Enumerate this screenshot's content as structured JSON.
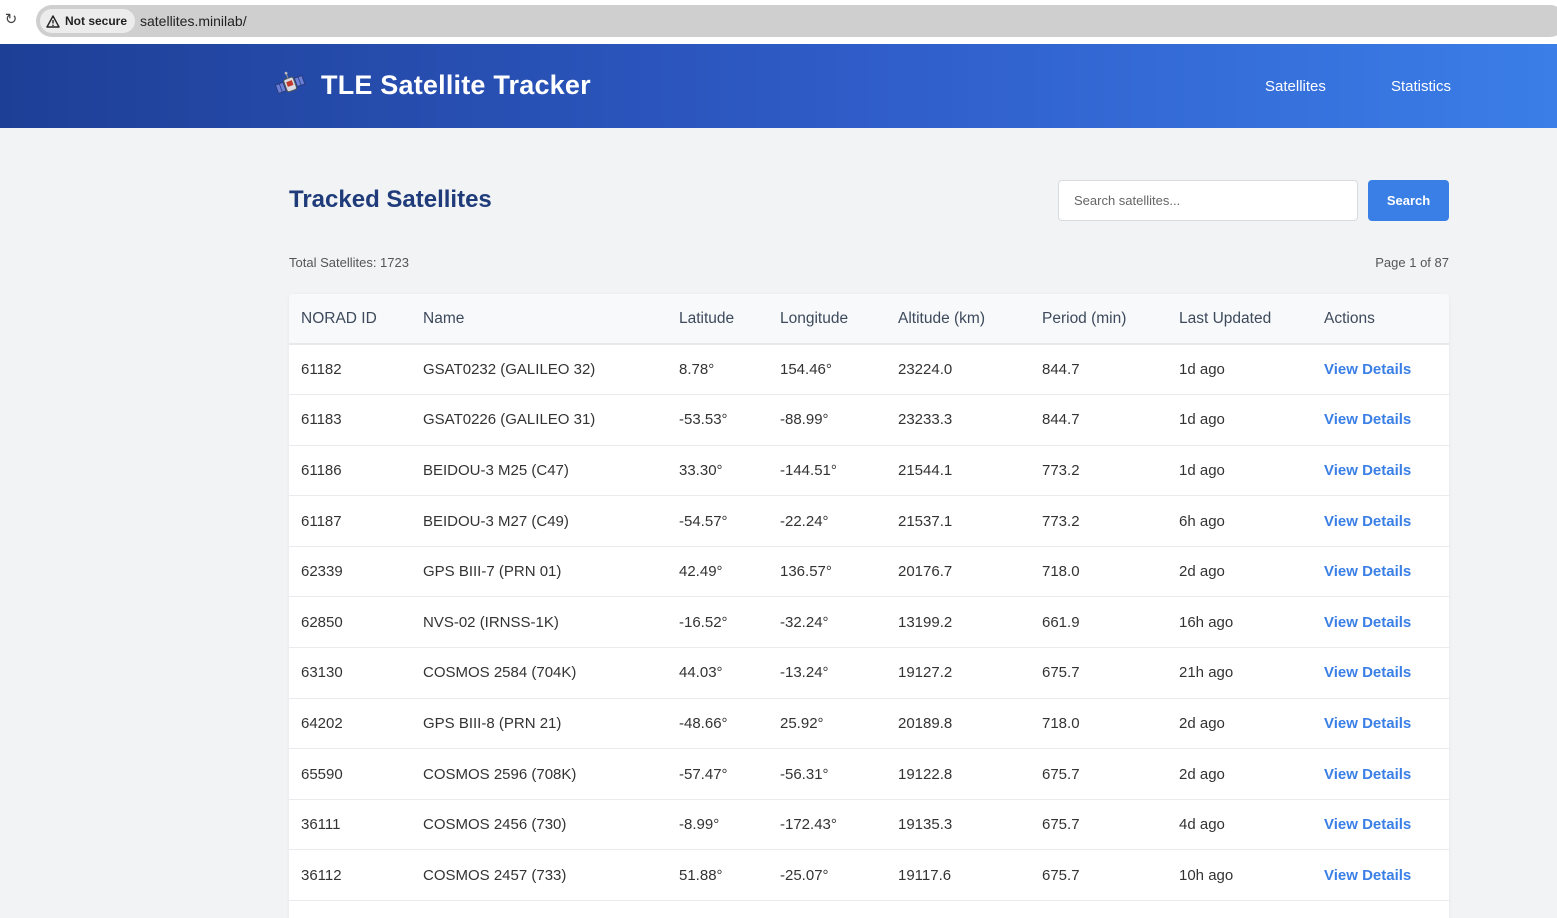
{
  "browser": {
    "security_label": "Not secure",
    "url": "satellites.minilab/"
  },
  "header": {
    "title": "TLE Satellite Tracker",
    "brand_icon": "satellite-icon",
    "nav": {
      "satellites": "Satellites",
      "statistics": "Statistics"
    }
  },
  "main": {
    "title": "Tracked Satellites",
    "search_placeholder": "Search satellites...",
    "search_button": "Search",
    "total": "Total Satellites: 1723",
    "page": "Page 1 of 87"
  },
  "table": {
    "columns": [
      "NORAD ID",
      "Name",
      "Latitude",
      "Longitude",
      "Altitude (km)",
      "Period (min)",
      "Last Updated",
      "Actions"
    ],
    "rows": [
      {
        "id": "61182",
        "name": "GSAT0232 (GALILEO 32)",
        "lat": "8.78°",
        "lon": "154.46°",
        "alt": "23224.0",
        "period": "844.7",
        "updated": "1d ago",
        "action": "View Details"
      },
      {
        "id": "61183",
        "name": "GSAT0226 (GALILEO 31)",
        "lat": "-53.53°",
        "lon": "-88.99°",
        "alt": "23233.3",
        "period": "844.7",
        "updated": "1d ago",
        "action": "View Details"
      },
      {
        "id": "61186",
        "name": "BEIDOU-3 M25 (C47)",
        "lat": "33.30°",
        "lon": "-144.51°",
        "alt": "21544.1",
        "period": "773.2",
        "updated": "1d ago",
        "action": "View Details"
      },
      {
        "id": "61187",
        "name": "BEIDOU-3 M27 (C49)",
        "lat": "-54.57°",
        "lon": "-22.24°",
        "alt": "21537.1",
        "period": "773.2",
        "updated": "6h ago",
        "action": "View Details"
      },
      {
        "id": "62339",
        "name": "GPS BIII-7 (PRN 01)",
        "lat": "42.49°",
        "lon": "136.57°",
        "alt": "20176.7",
        "period": "718.0",
        "updated": "2d ago",
        "action": "View Details"
      },
      {
        "id": "62850",
        "name": "NVS-02 (IRNSS-1K)",
        "lat": "-16.52°",
        "lon": "-32.24°",
        "alt": "13199.2",
        "period": "661.9",
        "updated": "16h ago",
        "action": "View Details"
      },
      {
        "id": "63130",
        "name": "COSMOS 2584 (704K)",
        "lat": "44.03°",
        "lon": "-13.24°",
        "alt": "19127.2",
        "period": "675.7",
        "updated": "21h ago",
        "action": "View Details"
      },
      {
        "id": "64202",
        "name": "GPS BIII-8 (PRN 21)",
        "lat": "-48.66°",
        "lon": "25.92°",
        "alt": "20189.8",
        "period": "718.0",
        "updated": "2d ago",
        "action": "View Details"
      },
      {
        "id": "65590",
        "name": "COSMOS 2596 (708K)",
        "lat": "-57.47°",
        "lon": "-56.31°",
        "alt": "19122.8",
        "period": "675.7",
        "updated": "2d ago",
        "action": "View Details"
      },
      {
        "id": "36111",
        "name": "COSMOS 2456 (730)",
        "lat": "-8.99°",
        "lon": "-172.43°",
        "alt": "19135.3",
        "period": "675.7",
        "updated": "4d ago",
        "action": "View Details"
      },
      {
        "id": "36112",
        "name": "COSMOS 2457 (733)",
        "lat": "51.88°",
        "lon": "-25.07°",
        "alt": "19117.6",
        "period": "675.7",
        "updated": "10h ago",
        "action": "View Details"
      }
    ]
  }
}
